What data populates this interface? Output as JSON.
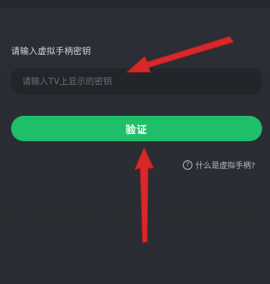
{
  "pairing": {
    "label": "请输入虚拟手柄密钥",
    "input_placeholder": "请输入TV上显示的密钥",
    "input_value": "",
    "verify_label": "验证",
    "help_text": "什么是虚拟手柄?",
    "help_icon": "help-circle-icon"
  },
  "colors": {
    "background": "#2a2d33",
    "input_background": "#22252a",
    "accent": "#1fbf6a",
    "annotation_arrow": "#d8282a"
  }
}
